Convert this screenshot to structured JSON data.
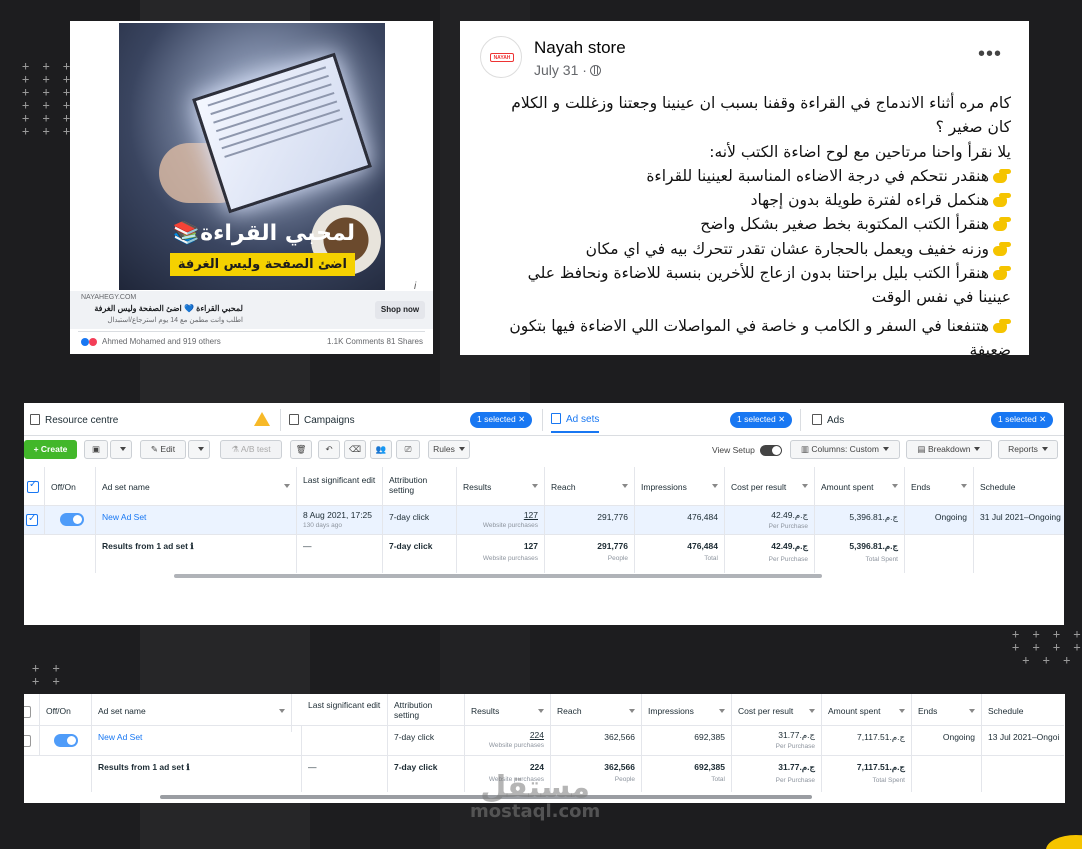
{
  "ad_card": {
    "headline": "لمحبي القراءة📚",
    "banner": "اضئ الصفحة وليس الغرفة",
    "domain": "NAYAHEGY.COM",
    "title": "لمحبي القراءة 💙 اضئ الصفحة وليس الغرفة",
    "subtitle": "اطلب وانت مطمن مع 14 يوم استرجاع/استبدال",
    "shop_label": "Shop now",
    "info_label": "i",
    "reactions": "Ahmed Mohamed and 919 others",
    "stats": "1.1K Comments  81 Shares"
  },
  "post": {
    "name": "Nayah store",
    "date": "July 31 ·",
    "more_label": "•••",
    "avatar_logo": "NAYAH",
    "line1": "كام مره أثناء الاندماج في القراءة وقفنا بسبب ان عينينا وجعتنا وزغللت و الكلام كان صغير ؟",
    "line2": "يلا نقرأ واحنا مرتاحين مع لوح اضاءة الكتب لأنه:",
    "bullets": [
      "هنقدر نتحكم في درجة الاضاءه  المناسبة لعينينا للقراءة",
      "هنكمل قراءه لفترة طويلة بدون إجهاد",
      "هنقرأ الكتب المكتوبة بخط صغير بشكل واضح",
      "وزنه خفيف ويعمل بالحجارة عشان تقدر تتحرك بيه في اي مكان",
      "هنقرأ الكتب بليل براحتنا بدون ازعاج للأخرين بنسبة للاضاءة ونحافظ علي عينينا في نفس الوقت",
      "هتنفعنا في السفر و الكامب و خاصة في المواصلات اللي الاضاءة فيها بتكون ضعيفة"
    ]
  },
  "ads_manager": {
    "tabs": {
      "resource_centre": "Resource centre",
      "campaigns": "Campaigns",
      "ad_sets": "Ad sets",
      "ads": "Ads",
      "selected_pill": "1 selected ✕"
    },
    "toolbar": {
      "create": "+ Create",
      "edit": "Edit",
      "ab_test": "A/B test",
      "rules": "Rules",
      "view_setup": "View Setup",
      "columns": "Columns: Custom",
      "breakdown": "Breakdown",
      "reports": "Reports"
    },
    "headers": {
      "off_on": "Off/On",
      "ad_set_name": "Ad set name",
      "last_edit": "Last significant edit",
      "attribution": "Attribution setting",
      "results": "Results",
      "reach": "Reach",
      "impressions": "Impressions",
      "cost": "Cost per result",
      "amount": "Amount spent",
      "ends": "Ends",
      "schedule": "Schedule"
    },
    "table1": {
      "row": {
        "name": "New Ad Set",
        "last_edit": "8 Aug 2021, 17:25",
        "last_edit_sub": "130 days ago",
        "attribution": "7-day click",
        "results": "127",
        "results_sub": "Website purchases",
        "reach": "291,776",
        "impressions": "476,484",
        "cost": "ج.م.‏42.49",
        "cost_sub": "Per Purchase",
        "amount": "ج.م.‏5,396.81",
        "ends": "Ongoing",
        "schedule": "31 Jul 2021–Ongoing"
      },
      "total": {
        "label": "Results from 1 ad set",
        "info": "ℹ",
        "last_edit": "—",
        "attribution": "7-day click",
        "results": "127",
        "results_sub": "Website purchases",
        "reach": "291,776",
        "reach_sub": "People",
        "impressions": "476,484",
        "impressions_sub": "Total",
        "cost": "ج.م.‏42.49",
        "cost_sub": "Per Purchase",
        "amount": "ج.م.‏5,396.81",
        "amount_sub": "Total Spent"
      }
    },
    "table2": {
      "row": {
        "name": "New Ad Set",
        "attribution": "7-day click",
        "results": "224",
        "results_sub": "Website purchases",
        "reach": "362,566",
        "impressions": "692,385",
        "cost": "ج.م.‏31.77",
        "cost_sub": "Per Purchase",
        "amount": "ج.م.‏7,117.51",
        "ends": "Ongoing",
        "schedule": "13 Jul 2021–Ongoi"
      },
      "total": {
        "label": "Results from 1 ad set",
        "info": "ℹ",
        "last_edit": "—",
        "attribution": "7-day click",
        "results": "224",
        "results_sub": "Website purchases",
        "reach": "362,566",
        "reach_sub": "People",
        "impressions": "692,385",
        "impressions_sub": "Total",
        "cost": "ج.م.‏31.77",
        "cost_sub": "Per Purchase",
        "amount": "ج.م.‏7,117.51",
        "amount_sub": "Total Spent"
      }
    }
  },
  "watermark": {
    "arabic": "مستقل",
    "latin": "mostaql.com"
  },
  "colors": {
    "background": "#1d1d1f",
    "fb_blue": "#1877f2",
    "create_green": "#42b72a",
    "warning": "#f7b928"
  }
}
